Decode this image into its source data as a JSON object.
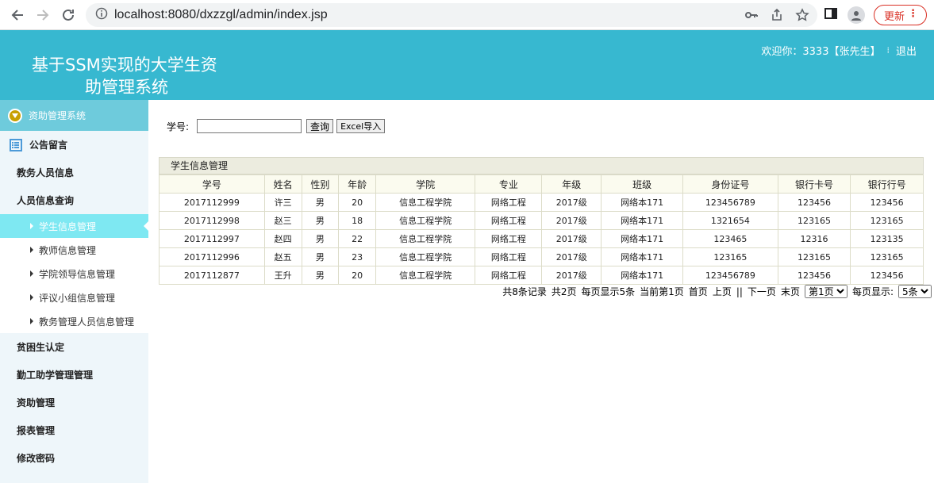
{
  "browser": {
    "url": "localhost:8080/dxzzgl/admin/index.jsp",
    "update_label": "更新"
  },
  "header": {
    "title_line1": "基于SSM实现的大学生资",
    "title_line2": "助管理系统",
    "welcome": "欢迎你：3333【张先生】",
    "logout": "退出"
  },
  "sidebar": {
    "top_label": "资助管理系统",
    "items_before": [
      "公告留言",
      "教务人员信息",
      "人员信息查询"
    ],
    "sub_items": [
      "学生信息管理",
      "教师信息管理",
      "学院领导信息管理",
      "评议小组信息管理",
      "教务管理人员信息管理"
    ],
    "items_after": [
      "贫困生认定",
      "勤工助学管理管理",
      "资助管理",
      "报表管理",
      "修改密码"
    ]
  },
  "search": {
    "label": "学号:",
    "query_button": "查询",
    "excel_button": "Excel导入"
  },
  "table": {
    "panel_title": "学生信息管理",
    "headers": [
      "学号",
      "姓名",
      "性别",
      "年龄",
      "学院",
      "专业",
      "年级",
      "班级",
      "身份证号",
      "银行卡号",
      "银行行号"
    ],
    "rows": [
      [
        "2017112999",
        "许三",
        "男",
        "20",
        "信息工程学院",
        "网络工程",
        "2017级",
        "网络本171",
        "123456789",
        "123456",
        "123456"
      ],
      [
        "2017112998",
        "赵三",
        "男",
        "18",
        "信息工程学院",
        "网络工程",
        "2017级",
        "网络本171",
        "1321654",
        "123165",
        "123165"
      ],
      [
        "2017112997",
        "赵四",
        "男",
        "22",
        "信息工程学院",
        "网络工程",
        "2017级",
        "网络本171",
        "123465",
        "12316",
        "123135"
      ],
      [
        "2017112996",
        "赵五",
        "男",
        "23",
        "信息工程学院",
        "网络工程",
        "2017级",
        "网络本171",
        "123165",
        "123165",
        "123165"
      ],
      [
        "2017112877",
        "王升",
        "男",
        "20",
        "信息工程学院",
        "网络工程",
        "2017级",
        "网络本171",
        "123456789",
        "123456",
        "123456"
      ]
    ]
  },
  "pager": {
    "total": "共8条记录",
    "pages": "共2页",
    "per_page_info": "每页显示5条",
    "current": "当前第1页",
    "first": "首页",
    "prev": "上页",
    "sep": "||",
    "next": "下一页",
    "last": "末页",
    "page_select": "第1页",
    "per_page_label": "每页显示:",
    "per_page_select": "5条"
  }
}
